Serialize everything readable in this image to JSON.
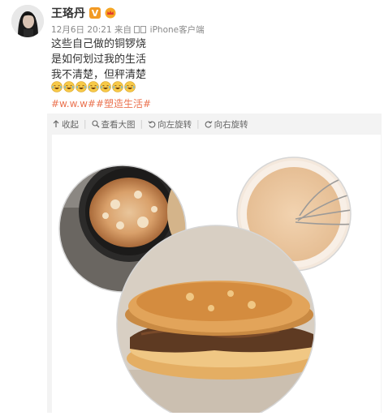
{
  "user": {
    "name": "王珞丹",
    "verified_badge": "V",
    "avatar_icon": "avatar-woman"
  },
  "post": {
    "date": "12月6日 20:21",
    "source_prefix": "来自",
    "source": "iPhone客户端",
    "lines": [
      "这些自己做的铜锣烧",
      "是如何划过我的生活",
      "我不清楚，但秤清楚"
    ],
    "emoji_count_label": "7",
    "hashtag": "#w.w.w##塑造生活#"
  },
  "toolbar": {
    "collapse_label": "收起",
    "view_large_label": "查看大图",
    "rotate_left_label": "向左旋转",
    "rotate_right_label": "向右旋转"
  },
  "colors": {
    "hashtag": "#eb7350",
    "verified": "#f29a24",
    "media_bg": "#f3f3f3"
  }
}
